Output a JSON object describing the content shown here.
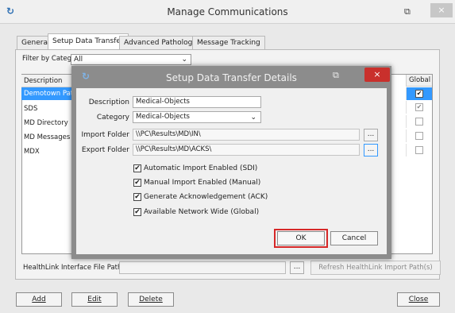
{
  "window": {
    "title": "Manage Communications",
    "app_icon": "↻",
    "restore_icon": "⧉",
    "close_icon": "×"
  },
  "tabs": [
    {
      "label": "General"
    },
    {
      "label": "Setup Data Transfer"
    },
    {
      "label": "Advanced Pathology"
    },
    {
      "label": "Message Tracking"
    }
  ],
  "filter": {
    "label": "Filter by Category",
    "value": "All",
    "chevron": "⌄"
  },
  "list": {
    "headers": {
      "description": "Description",
      "global": "Global"
    },
    "rows": [
      {
        "description": "Demotown Pat",
        "global": "✔"
      },
      {
        "description": "SDS",
        "global": "✔"
      },
      {
        "description": "MD Directory",
        "global": ""
      },
      {
        "description": "MD Messages",
        "global": ""
      },
      {
        "description": "MDX",
        "global": ""
      }
    ]
  },
  "healthlink": {
    "label": "HealthLink Interface File Path",
    "value": "",
    "browse": "...",
    "refresh": "Refresh HealthLink Import Path(s)"
  },
  "footer": {
    "add": "Add",
    "edit": "Edit",
    "delete": "Delete",
    "close": "Close"
  },
  "dialog": {
    "title": "Setup Data Transfer Details",
    "app_icon": "↻",
    "restore_icon": "⧉",
    "close_icon": "×",
    "description_label": "Description",
    "description_value": "Medical-Objects",
    "category_label": "Category",
    "category_value": "Medical-Objects",
    "category_chevron": "⌄",
    "import_label": "Import Folder",
    "import_value": "\\\\PC\\Results\\MD\\IN\\",
    "export_label": "Export Folder",
    "export_value": "\\\\PC\\Results\\MD\\ACKS\\",
    "browse": "...",
    "checks": [
      {
        "label": "Automatic Import Enabled (SDI)",
        "mark": "✔"
      },
      {
        "label": "Manual Import Enabled (Manual)",
        "mark": "✔"
      },
      {
        "label": "Generate Acknowledgement (ACK)",
        "mark": "✔"
      },
      {
        "label": "Available Network Wide (Global)",
        "mark": "✔"
      }
    ],
    "ok": "OK",
    "cancel": "Cancel"
  },
  "colors": {
    "selection": "#3399ff",
    "dialog_frame": "#8c8c8c",
    "dialog_close": "#c9302c",
    "ok_highlight": "#d62828"
  }
}
